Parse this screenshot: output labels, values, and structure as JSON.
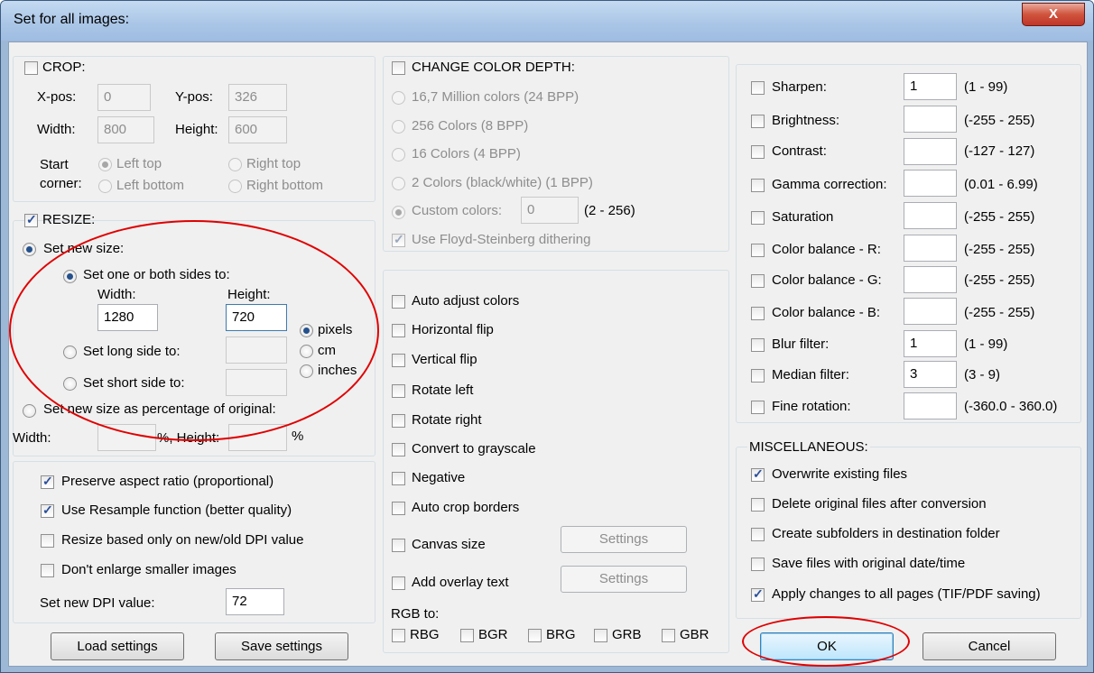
{
  "window": {
    "title": "Set for all images:",
    "close_label": "X"
  },
  "crop": {
    "label": "CROP:",
    "x_label": "X-pos:",
    "x_value": "0",
    "y_label": "Y-pos:",
    "y_value": "326",
    "width_label": "Width:",
    "width_value": "800",
    "height_label": "Height:",
    "height_value": "600",
    "start_label": "Start",
    "corner_label": "corner:",
    "left_top": "Left top",
    "right_top": "Right top",
    "left_bottom": "Left bottom",
    "right_bottom": "Right bottom"
  },
  "resize": {
    "label": "RESIZE:",
    "set_new_size": "Set new size:",
    "one_or_both": "Set one or both sides to:",
    "width_label": "Width:",
    "height_label": "Height:",
    "width_value": "1280",
    "height_value": "720",
    "long_side": "Set long side to:",
    "short_side": "Set short side to:",
    "unit_pixels": "pixels",
    "unit_cm": "cm",
    "unit_inches": "inches",
    "percentage": "Set new size as percentage of original:",
    "pct_width_label": "Width:",
    "pct_height_label": "%, Height:",
    "pct_suffix": "%"
  },
  "options": {
    "preserve_aspect": "Preserve aspect ratio (proportional)",
    "resample": "Use Resample function (better quality)",
    "dpi_based": "Resize based only on new/old DPI value",
    "dont_enlarge": "Don't enlarge smaller images",
    "dpi_label": "Set new DPI value:",
    "dpi_value": "72"
  },
  "buttons": {
    "load": "Load settings",
    "save": "Save settings",
    "ok": "OK",
    "cancel": "Cancel"
  },
  "color_depth": {
    "label": "CHANGE COLOR DEPTH:",
    "opt_24": "16,7 Million colors (24 BPP)",
    "opt_8": "256 Colors (8 BPP)",
    "opt_4": "16 Colors (4 BPP)",
    "opt_1": "2 Colors (black/white) (1 BPP)",
    "custom": "Custom colors:",
    "custom_value": "0",
    "custom_range": "(2 - 256)",
    "dither": "Use Floyd-Steinberg dithering"
  },
  "transforms": {
    "auto_adjust": "Auto adjust colors",
    "hflip": "Horizontal flip",
    "vflip": "Vertical flip",
    "rot_left": "Rotate left",
    "rot_right": "Rotate right",
    "grayscale": "Convert to grayscale",
    "negative": "Negative",
    "auto_crop": "Auto crop borders",
    "canvas": "Canvas size",
    "overlay": "Add overlay text",
    "settings": "Settings",
    "rgb_to": "RGB to:",
    "rbg": "RBG",
    "bgr": "BGR",
    "brg": "BRG",
    "grb": "GRB",
    "gbr": "GBR"
  },
  "filters": [
    {
      "label": "Sharpen:",
      "value": "1",
      "range": "(1  -  99)"
    },
    {
      "label": "Brightness:",
      "value": "",
      "range": "(-255  -  255)"
    },
    {
      "label": "Contrast:",
      "value": "",
      "range": "(-127  -  127)"
    },
    {
      "label": "Gamma correction:",
      "value": "",
      "range": "(0.01  -  6.99)"
    },
    {
      "label": "Saturation",
      "value": "",
      "range": "(-255  -  255)"
    },
    {
      "label": "Color balance - R:",
      "value": "",
      "range": "(-255  -  255)"
    },
    {
      "label": "Color balance - G:",
      "value": "",
      "range": "(-255  -  255)"
    },
    {
      "label": "Color balance - B:",
      "value": "",
      "range": "(-255  -  255)"
    },
    {
      "label": "Blur filter:",
      "value": "1",
      "range": "(1  -  99)"
    },
    {
      "label": "Median filter:",
      "value": "3",
      "range": "(3  -  9)"
    },
    {
      "label": "Fine rotation:",
      "value": "",
      "range": "(-360.0  -  360.0)"
    }
  ],
  "misc": {
    "label": "MISCELLANEOUS:",
    "overwrite": "Overwrite existing files",
    "delete_orig": "Delete original files after conversion",
    "subfolders": "Create subfolders in destination folder",
    "orig_date": "Save files with original date/time",
    "all_pages": "Apply changes to all pages (TIF/PDF saving)"
  },
  "colors": {
    "annotation": "#e00000",
    "titlebar": "#a9c5e6",
    "close_button": "#c0362a"
  }
}
